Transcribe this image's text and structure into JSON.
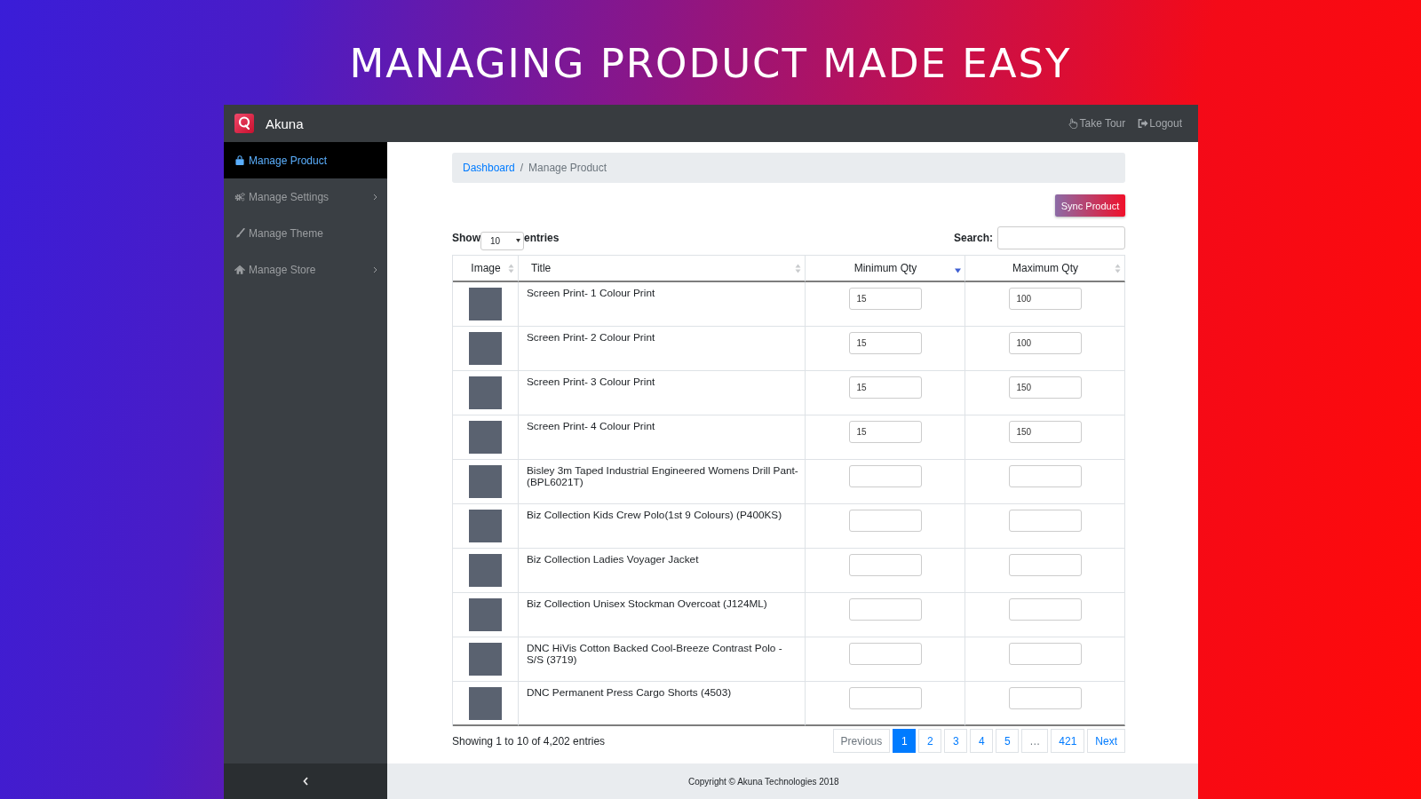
{
  "headline": "MANAGING PRODUCT MADE EASY",
  "top_bar": {
    "brand": "Akuna",
    "links": [
      {
        "label": "Take Tour"
      },
      {
        "label": "Logout"
      }
    ]
  },
  "sidebar": {
    "items": [
      {
        "label": "Manage Product",
        "selected": true,
        "has_submenu": false
      },
      {
        "label": "Manage Settings",
        "selected": false,
        "has_submenu": true
      },
      {
        "label": "Manage Theme",
        "selected": false,
        "has_submenu": false
      },
      {
        "label": "Manage Store",
        "selected": false,
        "has_submenu": true
      }
    ]
  },
  "breadcrumb": {
    "separator": "/",
    "items": [
      {
        "label": "Dashboard",
        "kind": "link"
      },
      {
        "label": "Manage Product",
        "kind": "current"
      }
    ]
  },
  "sync_button": {
    "label": "Sync Product"
  },
  "length_menu": {
    "prefix": "Show",
    "value": "10",
    "suffix": "entries"
  },
  "search": {
    "label": "Search:"
  },
  "table": {
    "columns": [
      {
        "label": "Image",
        "kind": "image",
        "sorted": false
      },
      {
        "label": "Title",
        "kind": "text",
        "sorted": false
      },
      {
        "label": "Minimum Qty",
        "kind": "number",
        "sorted": true
      },
      {
        "label": "Maximum Qty",
        "kind": "number",
        "sorted": false
      }
    ],
    "rows": [
      {
        "title": "Screen Print- 1 Colour Print",
        "minimum_qty": "15",
        "maximum_qty": "100"
      },
      {
        "title": "Screen Print- 2 Colour Print",
        "minimum_qty": "15",
        "maximum_qty": "100"
      },
      {
        "title": "Screen Print- 3 Colour Print",
        "minimum_qty": "15",
        "maximum_qty": "150"
      },
      {
        "title": "Screen Print- 4 Colour Print",
        "minimum_qty": "15",
        "maximum_qty": "150"
      },
      {
        "title": "Bisley 3m Taped Industrial Engineered Womens Drill Pant- (BPL6021T)"
      },
      {
        "title": "Biz Collection Kids Crew Polo(1st 9 Colours) (P400KS)"
      },
      {
        "title": "Biz Collection Ladies Voyager Jacket"
      },
      {
        "title": "Biz Collection Unisex Stockman Overcoat (J124ML)"
      },
      {
        "title": "DNC HiVis Cotton Backed Cool-Breeze Contrast Polo - S/S (3719)"
      },
      {
        "title": "DNC Permanent Press Cargo Shorts (4503)"
      }
    ]
  },
  "info": "Showing 1 to 10 of 4,202 entries",
  "pagination": [
    {
      "label": "Previous",
      "selected": false,
      "disabled": true
    },
    {
      "label": "1",
      "selected": true,
      "disabled": false
    },
    {
      "label": "2",
      "selected": false,
      "disabled": false
    },
    {
      "label": "3",
      "selected": false,
      "disabled": false
    },
    {
      "label": "4",
      "selected": false,
      "disabled": false
    },
    {
      "label": "5",
      "selected": false,
      "disabled": false
    },
    {
      "label": "…",
      "selected": false,
      "disabled": true
    },
    {
      "label": "421",
      "selected": false,
      "disabled": false
    },
    {
      "label": "Next",
      "selected": false,
      "disabled": false
    }
  ],
  "footer": {
    "copyright": "Copyright © Akuna Technologies 2018"
  }
}
